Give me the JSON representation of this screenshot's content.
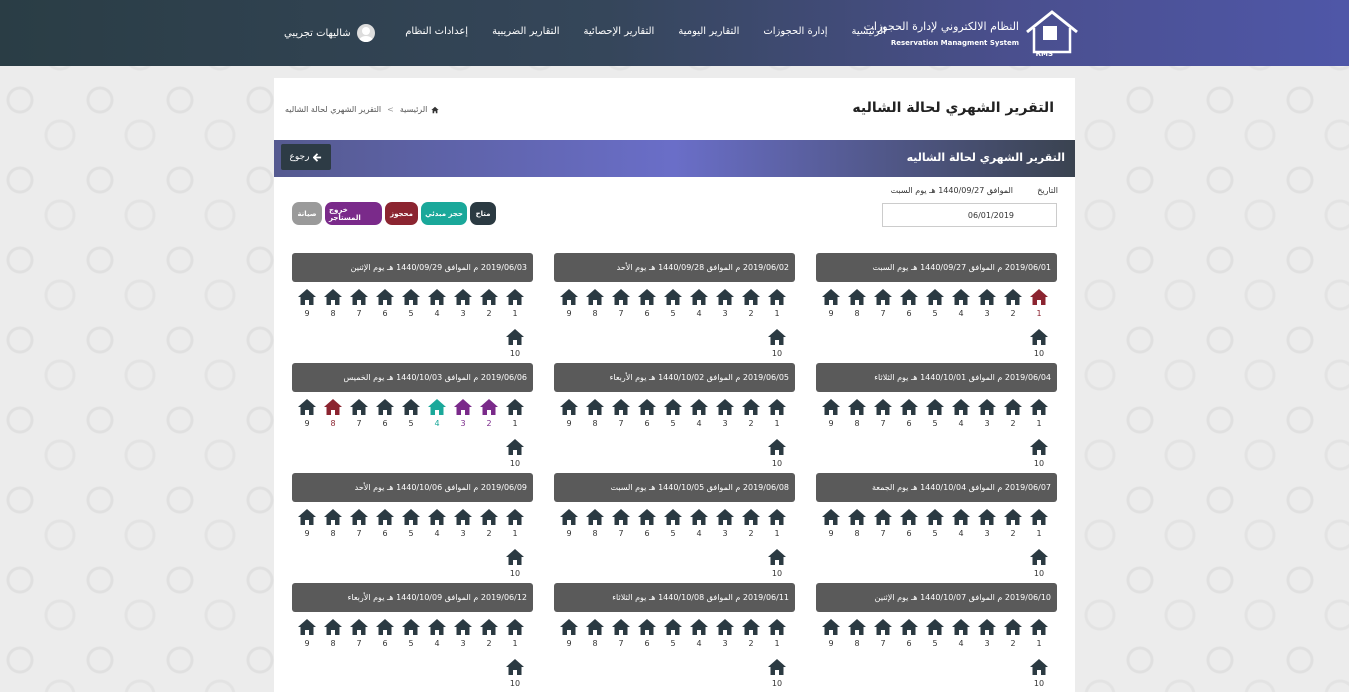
{
  "header": {
    "brand_ar": "النظام الالكتروني لإدارة الحجوزات",
    "brand_en": "Reservation Managment System",
    "logo_text": "RMS",
    "nav": [
      "الرئيسية",
      "إدارة الحجوزات",
      "التقارير اليومية",
      "التقارير الإحصائية",
      "التقارير الضريبية",
      "إعدادات النظام"
    ],
    "user": "شاليهات تجريبي"
  },
  "page": {
    "title": "التقرير الشهري لحالة الشاليه",
    "breadcrumb": {
      "home": "الرئيسية",
      "sep": ">",
      "current": "التقرير الشهري لحالة الشاليه"
    },
    "bar_title": "التقرير الشهري لحالة الشاليه",
    "back_label": "رجوع",
    "date_label": "التاريخ",
    "hijri_text": "الموافق 1440/09/27 هـ يوم السبت",
    "date_value": "06/01/2019"
  },
  "legend": [
    {
      "label": "متاح",
      "color": "#2b3a42"
    },
    {
      "label": "حجز مبدئي",
      "color": "#1aa89a"
    },
    {
      "label": "محجوز",
      "color": "#8b2430"
    },
    {
      "label": "خروج المستأجر",
      "color": "#7a2a8a"
    },
    {
      "label": "صيانة",
      "color": "#9a9a9a"
    }
  ],
  "colors": {
    "available": "#2b3a42",
    "initial": "#1aa89a",
    "booked": "#8b2430",
    "checkout": "#7a2a8a",
    "maintenance": "#9a9a9a"
  },
  "days": [
    {
      "header": "2019/06/01 م الموافق 1440/09/27 هـ يوم السبت",
      "status": {
        "1": "booked"
      }
    },
    {
      "header": "2019/06/02 م الموافق 1440/09/28 هـ يوم الأحد",
      "status": {}
    },
    {
      "header": "2019/06/03 م الموافق 1440/09/29 هـ يوم الإثنين",
      "status": {}
    },
    {
      "header": "2019/06/04 م الموافق 1440/10/01 هـ يوم الثلاثاء",
      "status": {}
    },
    {
      "header": "2019/06/05 م الموافق 1440/10/02 هـ يوم الأربعاء",
      "status": {}
    },
    {
      "header": "2019/06/06 م الموافق 1440/10/03 هـ يوم الخميس",
      "status": {
        "2": "checkout",
        "3": "checkout",
        "4": "initial",
        "8": "booked"
      }
    },
    {
      "header": "2019/06/07 م الموافق 1440/10/04 هـ يوم الجمعة",
      "status": {}
    },
    {
      "header": "2019/06/08 م الموافق 1440/10/05 هـ يوم السبت",
      "status": {}
    },
    {
      "header": "2019/06/09 م الموافق 1440/10/06 هـ يوم الأحد",
      "status": {}
    },
    {
      "header": "2019/06/10 م الموافق 1440/10/07 هـ يوم الإثنين",
      "status": {}
    },
    {
      "header": "2019/06/11 م الموافق 1440/10/08 هـ يوم الثلاثاء",
      "status": {}
    },
    {
      "header": "2019/06/12 م الموافق 1440/10/09 هـ يوم الأربعاء",
      "status": {}
    }
  ],
  "unit_numbers": [
    "1",
    "2",
    "3",
    "4",
    "5",
    "6",
    "7",
    "8",
    "9",
    "10"
  ]
}
